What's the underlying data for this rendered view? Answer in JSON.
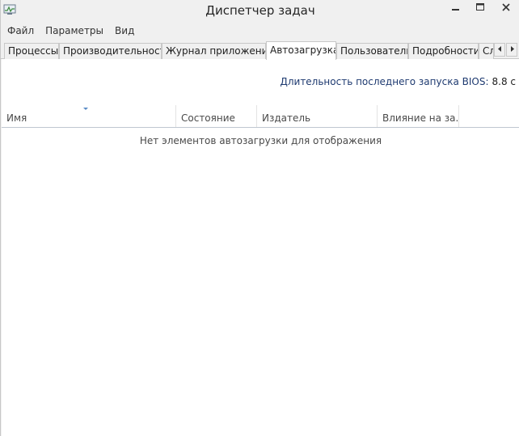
{
  "window": {
    "title": "Диспетчер задач"
  },
  "menu": {
    "file": "Файл",
    "options": "Параметры",
    "view": "Вид"
  },
  "tabs": [
    {
      "label": "Процессы"
    },
    {
      "label": "Производительность"
    },
    {
      "label": "Журнал приложений"
    },
    {
      "label": "Автозагрузка",
      "active": true
    },
    {
      "label": "Пользователи"
    },
    {
      "label": "Подробности"
    },
    {
      "label": "Сл"
    }
  ],
  "startup": {
    "bios_label": "Длительность последнего запуска BIOS:",
    "bios_value": "8.8 с",
    "columns": {
      "name": "Имя",
      "status": "Состояние",
      "publisher": "Издатель",
      "impact": "Влияние на за..."
    },
    "empty_message": "Нет элементов автозагрузки для отображения"
  },
  "icons": {
    "app": "task-manager-icon",
    "minimize": "minimize-icon",
    "maximize": "maximize-icon",
    "close": "close-icon",
    "tab_left": "chevron-left-icon",
    "tab_right": "chevron-right-icon",
    "sort": "sort-descending-icon"
  }
}
